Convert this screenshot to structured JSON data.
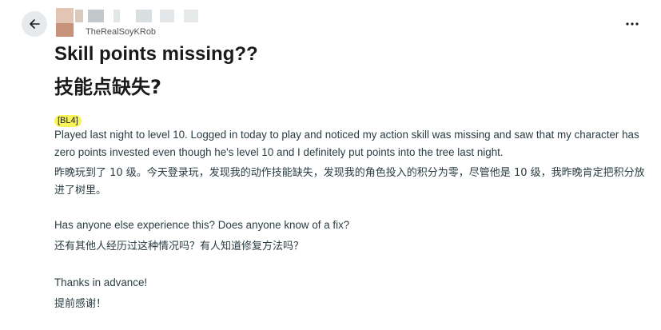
{
  "post": {
    "author": "TheRealSoyKRob",
    "title_en": "Skill points missing??",
    "title_zh": "技能点缺失?",
    "flair": "[BL4]",
    "paragraphs": [
      "Played last night to level 10. Logged in today to play and noticed my action skill was missing and saw that my character has zero points invested even though he's level 10 and I definitely put points into the tree last night.",
      "昨晚玩到了 10 级。今天登录玩，发现我的动作技能缺失，发现我的角色投入的积分为零，尽管他是 10 级，我昨晚肯定把积分放进了树里。",
      "Has anyone else experience this? Does anyone know of a fix?",
      "还有其他人经历过这种情况吗？有人知道修复方法吗？",
      "Thanks in advance!",
      "提前感谢！"
    ]
  },
  "icons": {
    "back": "back-arrow-icon",
    "more": "more-options-icon"
  }
}
